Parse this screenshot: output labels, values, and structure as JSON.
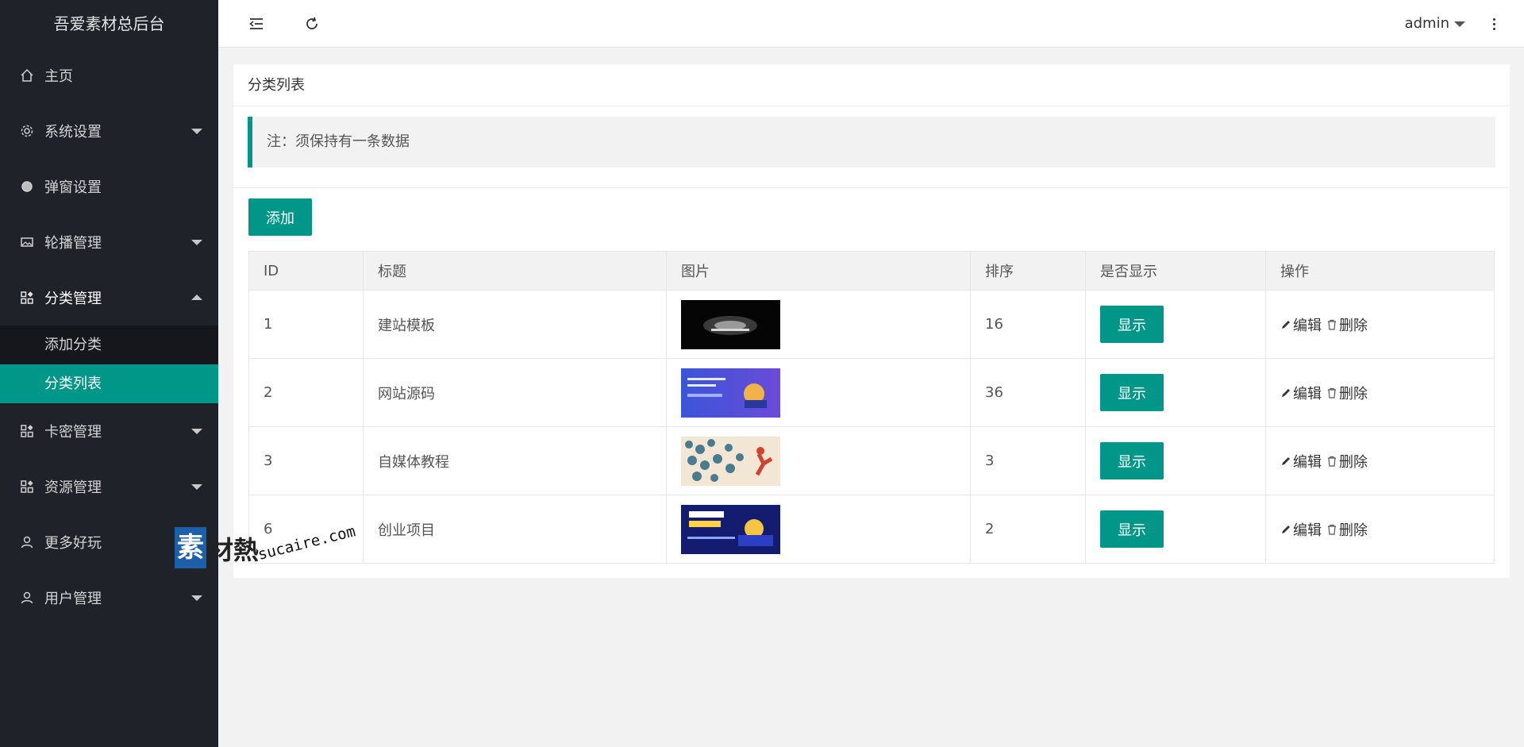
{
  "app": {
    "title": "吾爱素材总后台"
  },
  "sidebar": {
    "items": [
      {
        "label": "主页",
        "icon": "home-icon"
      },
      {
        "label": "系统设置",
        "icon": "gear-icon"
      },
      {
        "label": "弹窗设置",
        "icon": "circle-icon"
      },
      {
        "label": "轮播管理",
        "icon": "image-icon"
      },
      {
        "label": "分类管理",
        "icon": "apps-icon"
      },
      {
        "label": "卡密管理",
        "icon": "apps-icon"
      },
      {
        "label": "资源管理",
        "icon": "apps-icon"
      },
      {
        "label": "更多好玩",
        "icon": "user-icon"
      },
      {
        "label": "用户管理",
        "icon": "user-icon"
      }
    ],
    "submenu": [
      {
        "label": "添加分类"
      },
      {
        "label": "分类列表"
      }
    ]
  },
  "header": {
    "user": "admin"
  },
  "card": {
    "title": "分类列表",
    "note": "注：须保持有一条数据",
    "add_label": "添加"
  },
  "table": {
    "headers": [
      "ID",
      "标题",
      "图片",
      "排序",
      "是否显示",
      "操作"
    ],
    "rows": [
      {
        "id": "1",
        "title": "建站模板",
        "sort": "16",
        "show": "显示",
        "edit": "编辑",
        "delete": "删除"
      },
      {
        "id": "2",
        "title": "网站源码",
        "sort": "36",
        "show": "显示",
        "edit": "编辑",
        "delete": "删除"
      },
      {
        "id": "3",
        "title": "自媒体教程",
        "sort": "3",
        "show": "显示",
        "edit": "编辑",
        "delete": "删除"
      },
      {
        "id": "6",
        "title": "创业项目",
        "sort": "2",
        "show": "显示",
        "edit": "编辑",
        "delete": "删除"
      }
    ]
  },
  "watermark": {
    "box": "素",
    "cn": "材熱",
    "en": "sucaire.com"
  },
  "colors": {
    "accent": "#009688",
    "sidebar_bg": "#20222a",
    "submenu_bg": "#16171c"
  }
}
